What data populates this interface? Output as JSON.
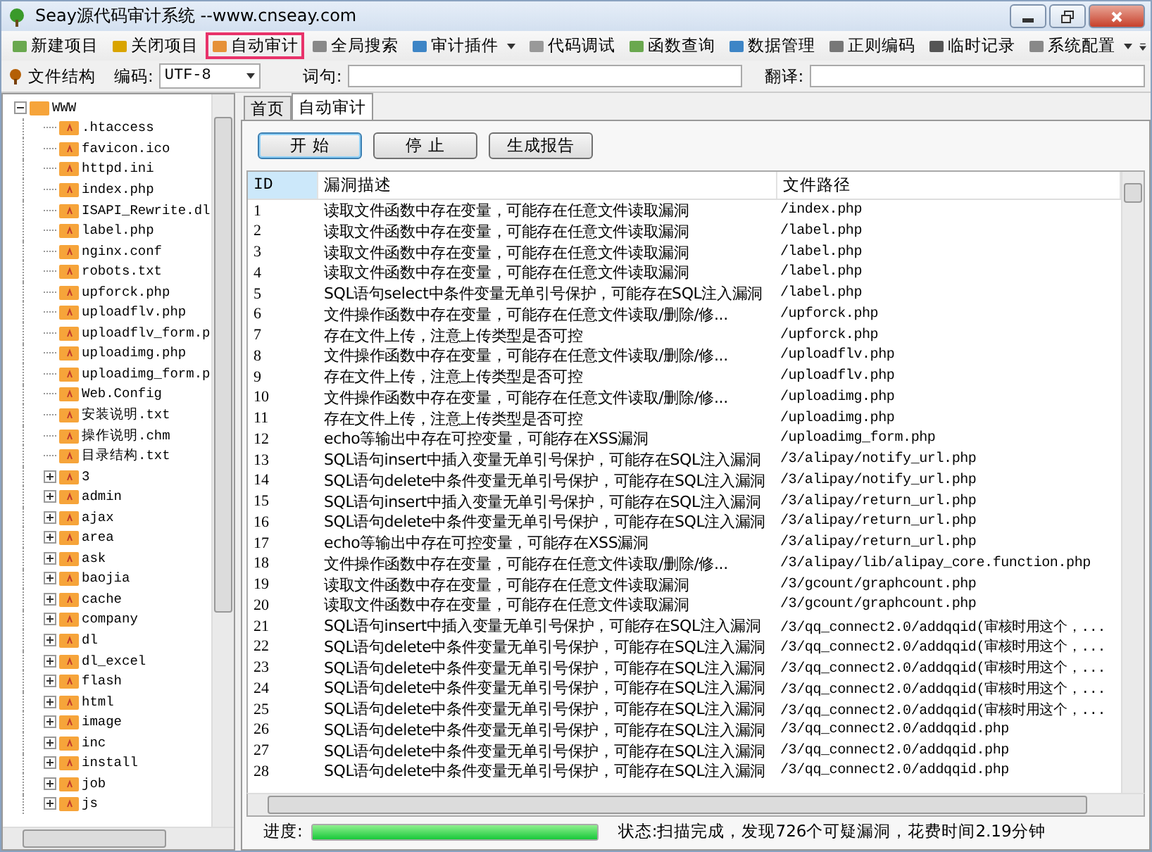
{
  "window": {
    "title": "Seay源代码审计系统  --www.cnseay.com"
  },
  "toolbar": [
    {
      "label": "新建项目",
      "selected": false,
      "dropdown": false
    },
    {
      "label": "关闭项目",
      "selected": false,
      "dropdown": false
    },
    {
      "label": "自动审计",
      "selected": true,
      "dropdown": false
    },
    {
      "label": "全局搜索",
      "selected": false,
      "dropdown": false
    },
    {
      "label": "审计插件",
      "selected": false,
      "dropdown": true
    },
    {
      "label": "代码调试",
      "selected": false,
      "dropdown": false
    },
    {
      "label": "函数查询",
      "selected": false,
      "dropdown": false
    },
    {
      "label": "数据管理",
      "selected": false,
      "dropdown": false
    },
    {
      "label": "正则编码",
      "selected": false,
      "dropdown": false
    },
    {
      "label": "临时记录",
      "selected": false,
      "dropdown": false
    },
    {
      "label": "系统配置",
      "selected": false,
      "dropdown": true
    }
  ],
  "subbar": {
    "tree_label": "文件结构",
    "encoding_label": "编码:",
    "encoding_value": "UTF-8",
    "word_label": "词句:",
    "translate_label": "翻译:"
  },
  "tree": [
    {
      "name": "WWW",
      "kind": "folder",
      "expanded": true,
      "children": [
        {
          "name": ".htaccess",
          "kind": "file"
        },
        {
          "name": "favicon.ico",
          "kind": "file"
        },
        {
          "name": "httpd.ini",
          "kind": "file"
        },
        {
          "name": "index.php",
          "kind": "file"
        },
        {
          "name": "ISAPI_Rewrite.dl",
          "kind": "file"
        },
        {
          "name": "label.php",
          "kind": "file"
        },
        {
          "name": "nginx.conf",
          "kind": "file"
        },
        {
          "name": "robots.txt",
          "kind": "file"
        },
        {
          "name": "upforck.php",
          "kind": "file"
        },
        {
          "name": "uploadflv.php",
          "kind": "file"
        },
        {
          "name": "uploadflv_form.p",
          "kind": "file"
        },
        {
          "name": "uploadimg.php",
          "kind": "file"
        },
        {
          "name": "uploadimg_form.p",
          "kind": "file"
        },
        {
          "name": "Web.Config",
          "kind": "file"
        },
        {
          "name": "安装说明.txt",
          "kind": "file"
        },
        {
          "name": "操作说明.chm",
          "kind": "file"
        },
        {
          "name": "目录结构.txt",
          "kind": "file"
        },
        {
          "name": "3",
          "kind": "folder",
          "expanded": false
        },
        {
          "name": "admin",
          "kind": "folder",
          "expanded": false
        },
        {
          "name": "ajax",
          "kind": "folder",
          "expanded": false
        },
        {
          "name": "area",
          "kind": "folder",
          "expanded": false
        },
        {
          "name": "ask",
          "kind": "folder",
          "expanded": false
        },
        {
          "name": "baojia",
          "kind": "folder",
          "expanded": false
        },
        {
          "name": "cache",
          "kind": "folder",
          "expanded": false
        },
        {
          "name": "company",
          "kind": "folder",
          "expanded": false
        },
        {
          "name": "dl",
          "kind": "folder",
          "expanded": false
        },
        {
          "name": "dl_excel",
          "kind": "folder",
          "expanded": false
        },
        {
          "name": "flash",
          "kind": "folder",
          "expanded": false
        },
        {
          "name": "html",
          "kind": "folder",
          "expanded": false
        },
        {
          "name": "image",
          "kind": "folder",
          "expanded": false
        },
        {
          "name": "inc",
          "kind": "folder",
          "expanded": false
        },
        {
          "name": "install",
          "kind": "folder",
          "expanded": false
        },
        {
          "name": "job",
          "kind": "folder",
          "expanded": false
        },
        {
          "name": "js",
          "kind": "folder",
          "expanded": false
        }
      ]
    }
  ],
  "tabs": [
    {
      "label": "首页",
      "selected": false
    },
    {
      "label": "自动审计",
      "selected": true
    }
  ],
  "actions": [
    {
      "label": "开 始",
      "default": true
    },
    {
      "label": "停 止",
      "default": false
    },
    {
      "label": "生成报告",
      "default": false
    }
  ],
  "table": {
    "columns": [
      {
        "label": "ID",
        "highlighted": true
      },
      {
        "label": "漏洞描述",
        "highlighted": false
      },
      {
        "label": "文件路径",
        "highlighted": false
      }
    ],
    "rows": [
      [
        "1",
        "读取文件函数中存在变量，可能存在任意文件读取漏洞",
        "/index.php"
      ],
      [
        "2",
        "读取文件函数中存在变量，可能存在任意文件读取漏洞",
        "/label.php"
      ],
      [
        "3",
        "读取文件函数中存在变量，可能存在任意文件读取漏洞",
        "/label.php"
      ],
      [
        "4",
        "读取文件函数中存在变量，可能存在任意文件读取漏洞",
        "/label.php"
      ],
      [
        "5",
        "SQL语句select中条件变量无单引号保护，可能存在SQL注入漏洞",
        "/label.php"
      ],
      [
        "6",
        "文件操作函数中存在变量，可能存在任意文件读取/删除/修...",
        "/upforck.php"
      ],
      [
        "7",
        "存在文件上传，注意上传类型是否可控",
        "/upforck.php"
      ],
      [
        "8",
        "文件操作函数中存在变量，可能存在任意文件读取/删除/修...",
        "/uploadflv.php"
      ],
      [
        "9",
        "存在文件上传，注意上传类型是否可控",
        "/uploadflv.php"
      ],
      [
        "10",
        "文件操作函数中存在变量，可能存在任意文件读取/删除/修...",
        "/uploadimg.php"
      ],
      [
        "11",
        "存在文件上传，注意上传类型是否可控",
        "/uploadimg.php"
      ],
      [
        "12",
        "echo等输出中存在可控变量，可能存在XSS漏洞",
        "/uploadimg_form.php"
      ],
      [
        "13",
        "SQL语句insert中插入变量无单引号保护，可能存在SQL注入漏洞",
        "/3/alipay/notify_url.php"
      ],
      [
        "14",
        "SQL语句delete中条件变量无单引号保护，可能存在SQL注入漏洞",
        "/3/alipay/notify_url.php"
      ],
      [
        "15",
        "SQL语句insert中插入变量无单引号保护，可能存在SQL注入漏洞",
        "/3/alipay/return_url.php"
      ],
      [
        "16",
        "SQL语句delete中条件变量无单引号保护，可能存在SQL注入漏洞",
        "/3/alipay/return_url.php"
      ],
      [
        "17",
        "echo等输出中存在可控变量，可能存在XSS漏洞",
        "/3/alipay/return_url.php"
      ],
      [
        "18",
        "文件操作函数中存在变量，可能存在任意文件读取/删除/修...",
        "/3/alipay/lib/alipay_core.function.php"
      ],
      [
        "19",
        "读取文件函数中存在变量，可能存在任意文件读取漏洞",
        "/3/gcount/graphcount.php"
      ],
      [
        "20",
        "读取文件函数中存在变量，可能存在任意文件读取漏洞",
        "/3/gcount/graphcount.php"
      ],
      [
        "21",
        "SQL语句insert中插入变量无单引号保护，可能存在SQL注入漏洞",
        "/3/qq_connect2.0/addqqid(审核时用这个，..."
      ],
      [
        "22",
        "SQL语句delete中条件变量无单引号保护，可能存在SQL注入漏洞",
        "/3/qq_connect2.0/addqqid(审核时用这个，..."
      ],
      [
        "23",
        "SQL语句delete中条件变量无单引号保护，可能存在SQL注入漏洞",
        "/3/qq_connect2.0/addqqid(审核时用这个，..."
      ],
      [
        "24",
        "SQL语句delete中条件变量无单引号保护，可能存在SQL注入漏洞",
        "/3/qq_connect2.0/addqqid(审核时用这个，..."
      ],
      [
        "25",
        "SQL语句delete中条件变量无单引号保护，可能存在SQL注入漏洞",
        "/3/qq_connect2.0/addqqid(审核时用这个，..."
      ],
      [
        "26",
        "SQL语句delete中条件变量无单引号保护，可能存在SQL注入漏洞",
        "/3/qq_connect2.0/addqqid.php"
      ],
      [
        "27",
        "SQL语句delete中条件变量无单引号保护，可能存在SQL注入漏洞",
        "/3/qq_connect2.0/addqqid.php"
      ],
      [
        "28",
        "SQL语句delete中条件变量无单引号保护，可能存在SQL注入漏洞",
        "/3/qq_connect2.0/addqqid.php"
      ]
    ]
  },
  "status": {
    "progress_label": "进度:",
    "level": 1.0,
    "text": "状态:扫描完成，发现726个可疑漏洞，花费时间2.19分钟"
  }
}
